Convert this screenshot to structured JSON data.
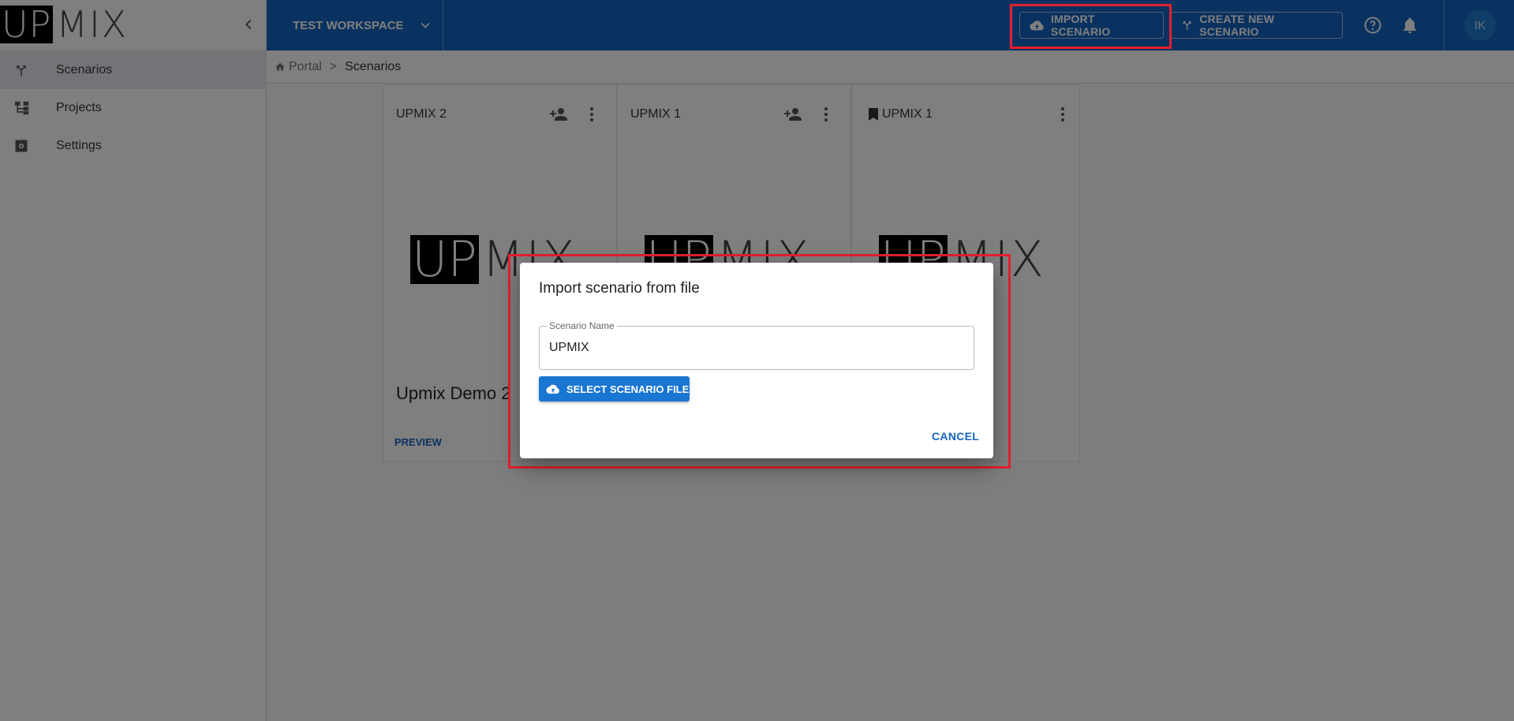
{
  "app": {
    "logo_left": "UP",
    "logo_right": "MIX"
  },
  "sidebar": {
    "items": [
      {
        "label": "Scenarios",
        "icon": "scenarios-icon",
        "active": true
      },
      {
        "label": "Projects",
        "icon": "projects-icon",
        "active": false
      },
      {
        "label": "Settings",
        "icon": "settings-icon",
        "active": false
      }
    ]
  },
  "header": {
    "workspace": "TEST WORKSPACE",
    "import_label": "IMPORT SCENARIO",
    "create_label": "CREATE NEW SCENARIO",
    "avatar_initials": "IK",
    "color": "#1565c0"
  },
  "breadcrumb": {
    "root": "Portal",
    "separator": ">",
    "current": "Scenarios"
  },
  "cards": [
    {
      "title": "UPMIX 2",
      "description": "Upmix Demo 2",
      "action": "PREVIEW",
      "bookmarked": false,
      "shared_icon": true
    },
    {
      "title": "UPMIX 1",
      "description": "",
      "action": "",
      "bookmarked": false,
      "shared_icon": true
    },
    {
      "title": "UPMIX 1",
      "description": "",
      "action": "",
      "bookmarked": true,
      "shared_icon": false
    }
  ],
  "dialog": {
    "title": "Import scenario from file",
    "field_label": "Scenario Name",
    "field_value": "UPMIX",
    "select_file_label": "SELECT SCENARIO FILE",
    "cancel_label": "CANCEL"
  },
  "highlight_color": "#e5202e"
}
